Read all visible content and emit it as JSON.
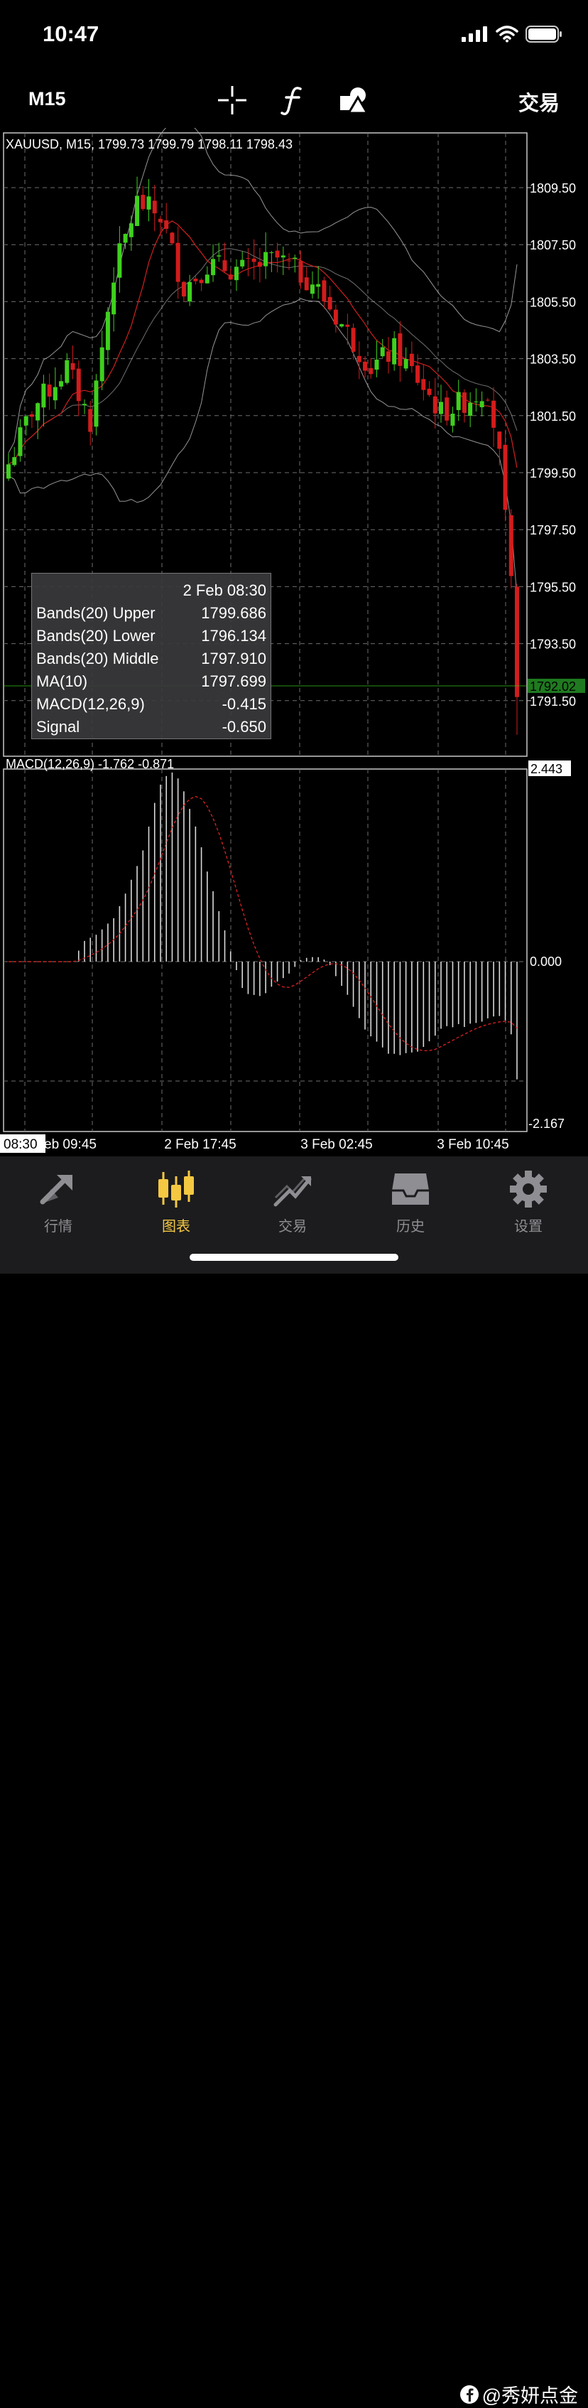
{
  "status": {
    "time": "10:47"
  },
  "toolbar": {
    "timeframe": "M15",
    "trade_label": "交易"
  },
  "chart": {
    "header": "XAUUSD, M15, 1799.73 1799.79 1798.11 1798.43",
    "price_labels": [
      "1809.50",
      "1807.50",
      "1805.50",
      "1803.50",
      "1801.50",
      "1799.50",
      "1797.50",
      "1795.50",
      "1793.50",
      "1791.50"
    ],
    "current_price": "1792.02",
    "macd_header": "MACD(12,26,9) -1.762 -0.871",
    "macd_max": "2.443",
    "macd_zero": "0.000",
    "macd_min": "-2.167",
    "time_labels": [
      "eb 09:45",
      "2 Feb 17:45",
      "3 Feb 02:45",
      "3 Feb 10:45"
    ],
    "cursor_time": "08:30",
    "colors": {
      "up": "#3fd01e",
      "down": "#d21c1c",
      "ma": "#d02020",
      "bands": "#bcbcbc",
      "grid": "#6e6e6e",
      "current_price_bg": "#1f7a1f"
    }
  },
  "info": {
    "date": "2 Feb 08:30",
    "rows": [
      {
        "label": "Bands(20) Upper",
        "value": "1799.686"
      },
      {
        "label": "Bands(20) Lower",
        "value": "1796.134"
      },
      {
        "label": "Bands(20) Middle",
        "value": "1797.910"
      },
      {
        "label": "MA(10)",
        "value": "1797.699"
      },
      {
        "label": "MACD(12,26,9)",
        "value": "-0.415"
      },
      {
        "label": "Signal",
        "value": "-0.650"
      }
    ]
  },
  "tabs": [
    {
      "label": "行情",
      "icon": "quotes-arrows-icon"
    },
    {
      "label": "图表",
      "icon": "candlestick-icon",
      "active": true
    },
    {
      "label": "交易",
      "icon": "trade-trend-icon"
    },
    {
      "label": "历史",
      "icon": "history-inbox-icon"
    },
    {
      "label": "设置",
      "icon": "gear-icon"
    }
  ],
  "watermark": "@秀妍点金"
}
